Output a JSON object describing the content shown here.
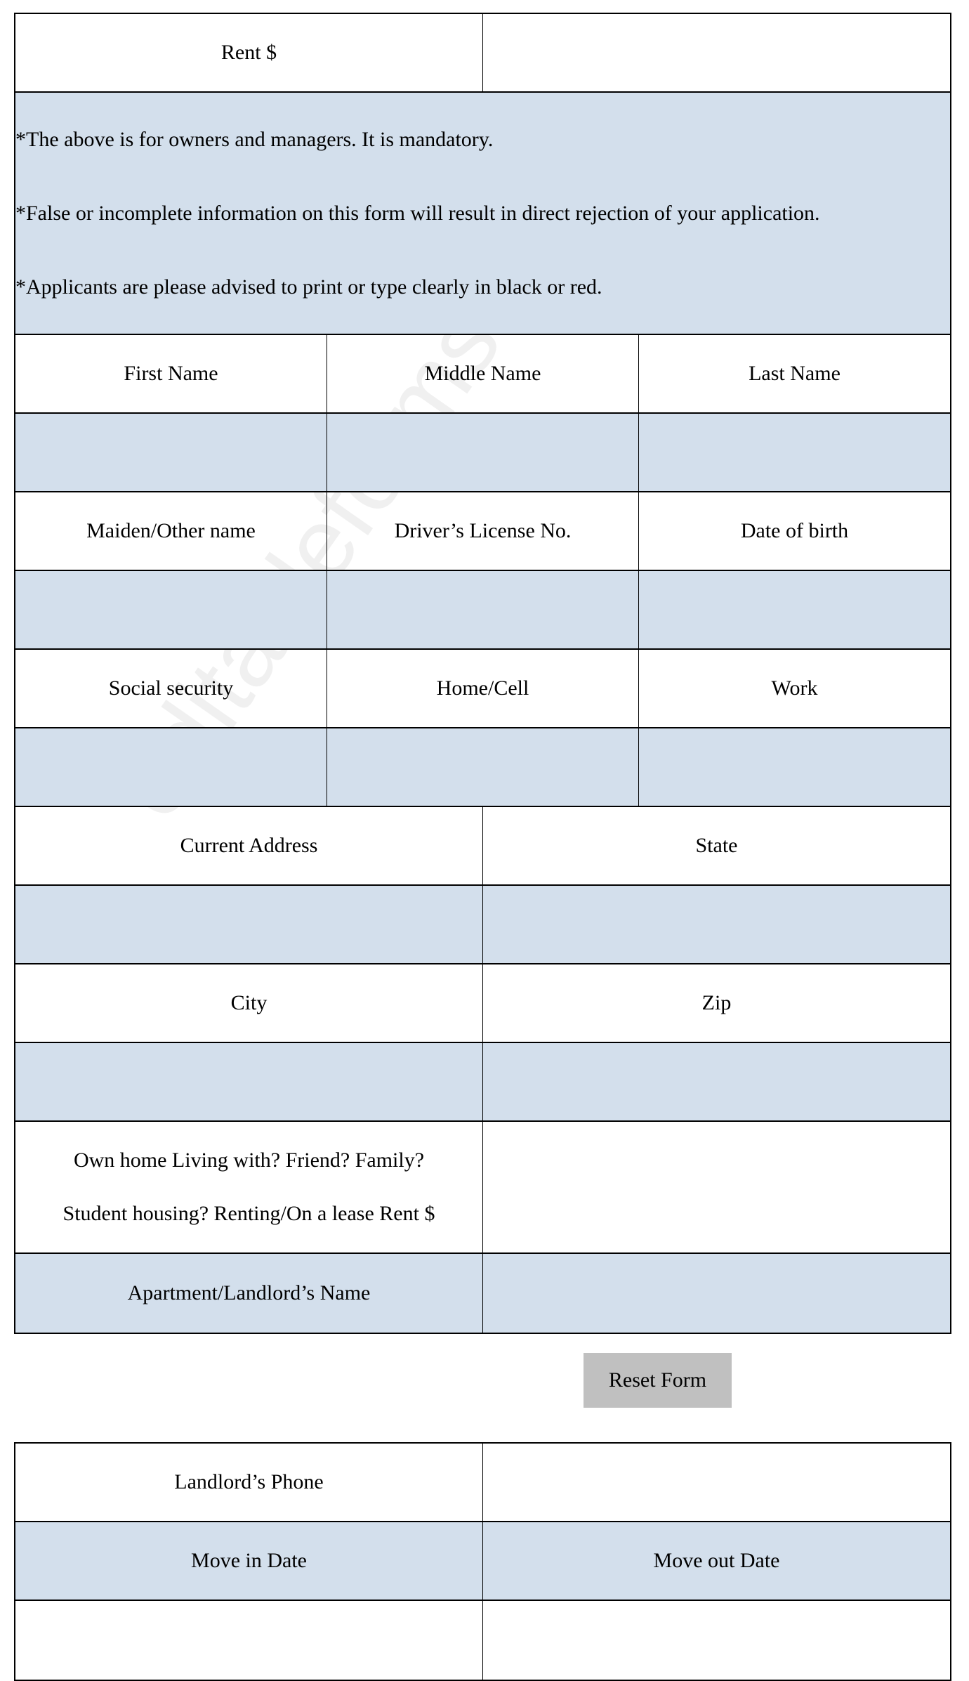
{
  "form": {
    "rent_label": "Rent $",
    "notes": [
      "*The above is for owners and managers. It is mandatory.",
      "*False or incomplete information on this form will result in direct rejection of your application.",
      "*Applicants are please advised to print or type clearly in black or red."
    ],
    "labels": {
      "first_name": "First Name",
      "middle_name": "Middle Name",
      "last_name": "Last Name",
      "maiden_name": "Maiden/Other name",
      "drivers_license": "Driver’s License No.",
      "dob": "Date of birth",
      "ssn": "Social security",
      "home_cell": "Home/Cell",
      "work": "Work",
      "current_address": "Current Address",
      "state": "State",
      "city": "City",
      "zip": "Zip",
      "living_line1": "Own home Living with? Friend? Family?",
      "living_line2": "Student housing? Renting/On a lease Rent $",
      "landlord_name": "Apartment/Landlord’s Name",
      "landlord_phone": "Landlord’s Phone",
      "move_in": "Move in Date",
      "move_out": "Move out Date"
    },
    "reset_label": "Reset Form"
  },
  "watermark": "editableforms.com",
  "colors": {
    "field_fill": "#d3dfec",
    "button": "#c0c0c0"
  }
}
